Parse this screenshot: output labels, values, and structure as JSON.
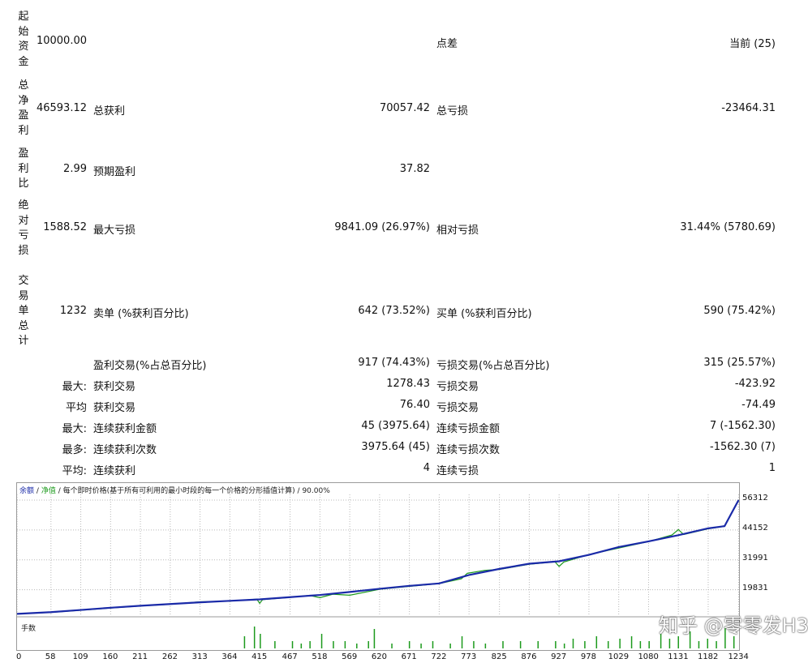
{
  "left_labels": {
    "initial_deposit": "起始资金",
    "total_net_profit": "总净盈利",
    "profit_factor": "盈利比",
    "absolute_drawdown": "绝对亏损",
    "total_trades": "交易单总计"
  },
  "stats": {
    "initial_deposit": "10000.00",
    "spread_label": "点差",
    "spread_value": "当前 (25)",
    "total_net_profit": "46593.12",
    "gross_profit_label": "总获利",
    "gross_profit": "70057.42",
    "gross_loss_label": "总亏损",
    "gross_loss": "-23464.31",
    "profit_factor": "2.99",
    "expected_payoff_label": "预期盈利",
    "expected_payoff": "37.82",
    "absolute_drawdown": "1588.52",
    "max_drawdown_label": "最大亏损",
    "max_drawdown": "9841.09 (26.97%)",
    "relative_drawdown_label": "相对亏损",
    "relative_drawdown": "31.44% (5780.69)",
    "total_trades": "1232",
    "short_label": "卖单 (%获利百分比)",
    "short_value": "642 (73.52%)",
    "long_label": "买单 (%获利百分比)",
    "long_value": "590 (75.42%)",
    "profit_trades_label": "盈利交易(%占总百分比)",
    "profit_trades": "917 (74.43%)",
    "loss_trades_label": "亏损交易(%占总百分比)",
    "loss_trades": "315 (25.57%)",
    "largest_prefix": "最大:",
    "largest_profit_label": "获利交易",
    "largest_profit": "1278.43",
    "largest_loss_label": "亏损交易",
    "largest_loss": "-423.92",
    "average_prefix": "平均",
    "average_profit_label": "获利交易",
    "average_profit": "76.40",
    "average_loss_label": "亏损交易",
    "average_loss": "-74.49",
    "max_consec_prefix": "最大:",
    "max_consec_wins_label": "连续获利金额",
    "max_consec_wins": "45 (3975.64)",
    "max_consec_losses_label": "连续亏损金额",
    "max_consec_losses": "7 (-1562.30)",
    "maximal_prefix": "最多:",
    "maximal_consec_profit_label": "连续获利次数",
    "maximal_consec_profit": "3975.64 (45)",
    "maximal_consec_loss_label": "连续亏损次数",
    "maximal_consec_loss": "-1562.30 (7)",
    "avg_consec_prefix": "平均:",
    "avg_consec_wins_label": "连续获利",
    "avg_consec_wins": "4",
    "avg_consec_losses_label": "连续亏损",
    "avg_consec_losses": "1"
  },
  "chart_data": {
    "type": "line",
    "legend": {
      "balance": "余额",
      "equity": "净值",
      "sep": "/",
      "description": "每个即时价格(基于所有可利用的最小时段的每一个价格的分形插值计算)",
      "quality": "90.00%"
    },
    "volume_label": "手数",
    "y_ticks": [
      "56312",
      "44152",
      "31991",
      "19831"
    ],
    "y_tick_values": [
      56312,
      44152,
      31991,
      19831
    ],
    "x_ticks": [
      "0",
      "58",
      "109",
      "160",
      "211",
      "262",
      "313",
      "364",
      "415",
      "467",
      "518",
      "569",
      "620",
      "671",
      "722",
      "773",
      "825",
      "876",
      "927",
      "978",
      "1029",
      "1080",
      "1131",
      "1182",
      "1234"
    ],
    "xlim": [
      0,
      1232
    ],
    "ylim": [
      9800,
      58600
    ],
    "colors": {
      "balance": "#1a2aa8",
      "equity": "#1c9a1c",
      "volume": "#1c9a1c",
      "grid": "#b8b8b8"
    },
    "series": [
      {
        "name": "余额",
        "x": [
          0,
          58,
          109,
          160,
          211,
          262,
          313,
          364,
          415,
          467,
          518,
          569,
          620,
          671,
          722,
          773,
          825,
          876,
          927,
          978,
          1029,
          1080,
          1131,
          1182,
          1210,
          1234
        ],
        "values": [
          10000,
          10700,
          11600,
          12500,
          13300,
          14000,
          14700,
          15300,
          15900,
          16800,
          17700,
          18900,
          20200,
          21400,
          22400,
          25800,
          28300,
          30400,
          31400,
          34000,
          37200,
          39500,
          42000,
          44800,
          45700,
          56300
        ]
      },
      {
        "name": "净值",
        "x": [
          0,
          58,
          109,
          160,
          211,
          262,
          313,
          364,
          410,
          415,
          420,
          467,
          500,
          518,
          540,
          569,
          620,
          671,
          722,
          760,
          770,
          800,
          825,
          876,
          920,
          927,
          935,
          978,
          1029,
          1080,
          1120,
          1131,
          1140,
          1182,
          1210,
          1234
        ],
        "values": [
          10000,
          10600,
          11500,
          12400,
          13200,
          13900,
          14900,
          15200,
          16000,
          14300,
          15800,
          16700,
          17500,
          16600,
          18000,
          17600,
          20000,
          21200,
          22300,
          24300,
          26500,
          27700,
          28100,
          30200,
          31200,
          29300,
          31100,
          34100,
          36800,
          39400,
          42100,
          44300,
          42300,
          44600,
          45600,
          56300
        ]
      }
    ],
    "volume_bars": {
      "note": "relative lot sizes",
      "x": [
        388,
        405,
        415,
        440,
        470,
        485,
        500,
        520,
        540,
        560,
        580,
        600,
        610,
        640,
        670,
        690,
        710,
        740,
        760,
        780,
        800,
        830,
        860,
        890,
        920,
        935,
        950,
        970,
        990,
        1010,
        1030,
        1050,
        1065,
        1080,
        1100,
        1115,
        1130,
        1150,
        1165,
        1180,
        1195,
        1210,
        1225
      ],
      "values": [
        0.5,
        0.9,
        0.6,
        0.3,
        0.3,
        0.2,
        0.3,
        0.6,
        0.3,
        0.3,
        0.2,
        0.3,
        0.8,
        0.2,
        0.3,
        0.2,
        0.3,
        0.2,
        0.5,
        0.3,
        0.2,
        0.3,
        0.3,
        0.3,
        0.3,
        0.2,
        0.4,
        0.3,
        0.5,
        0.3,
        0.4,
        0.5,
        0.3,
        0.3,
        0.6,
        0.4,
        0.5,
        0.7,
        0.3,
        0.4,
        0.3,
        0.9,
        0.5
      ]
    }
  },
  "watermark": "知乎 @零零发H3"
}
